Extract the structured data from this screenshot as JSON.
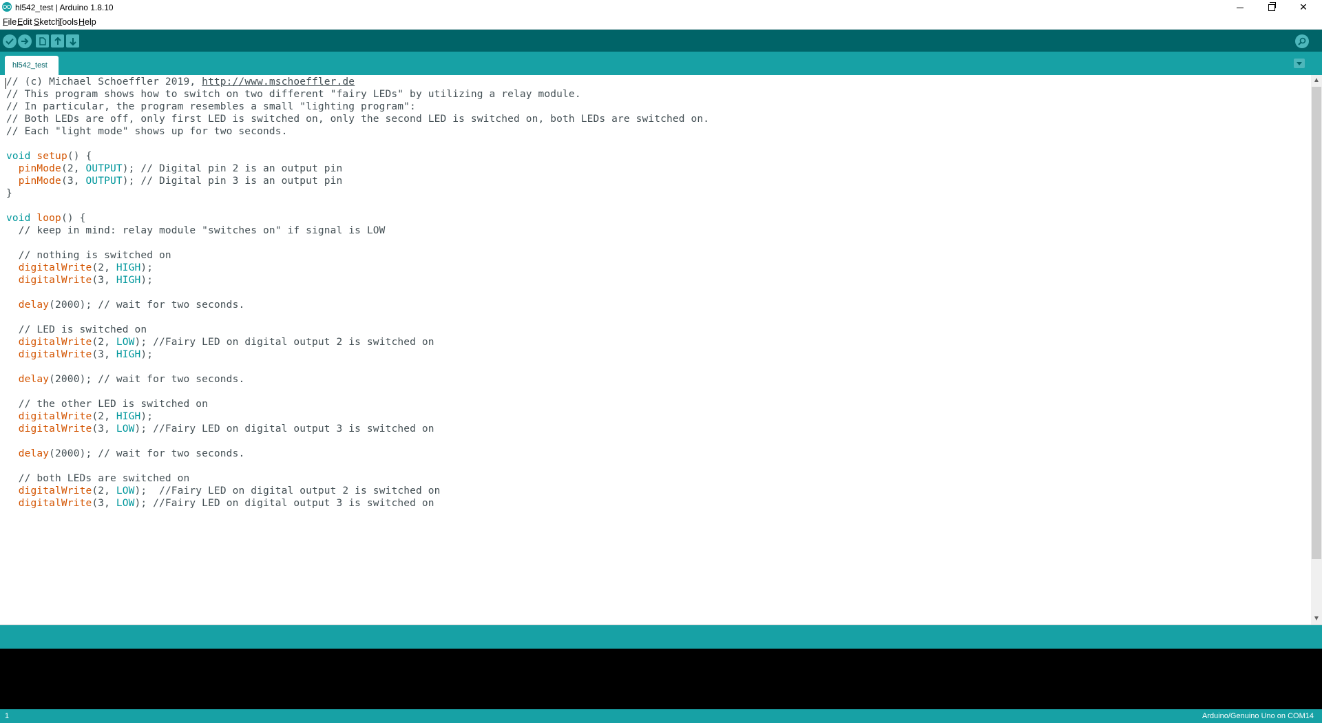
{
  "window": {
    "title": "hl542_test | Arduino 1.8.10",
    "controls": {
      "minimize": "minimize-icon",
      "restore": "restore-icon",
      "close": "✕"
    }
  },
  "menu": {
    "items": [
      "File",
      "Edit",
      "Sketch",
      "Tools",
      "Help"
    ]
  },
  "toolbar": {
    "buttons": [
      {
        "name": "verify",
        "icon": "checkmark-icon"
      },
      {
        "name": "upload",
        "icon": "arrow-right-icon"
      },
      {
        "name": "new",
        "icon": "document-icon"
      },
      {
        "name": "open",
        "icon": "arrow-up-icon"
      },
      {
        "name": "save",
        "icon": "arrow-down-icon"
      }
    ],
    "serial_monitor_icon": "magnifier-icon"
  },
  "tabs": {
    "items": [
      {
        "label": "hl542_test",
        "active": true
      }
    ],
    "menu_icon": "chevron-down-icon"
  },
  "editor": {
    "lines": [
      "// (c) Michael Schoeffler 2019, http://www.mschoeffler.de",
      "// This program shows how to switch on two different \"fairy LEDs\" by utilizing a relay module.",
      "// In particular, the program resembles a small \"lighting program\":",
      "// Both LEDs are off, only first LED is switched on, only the second LED is switched on, both LEDs are switched on.",
      "// Each \"light mode\" shows up for two seconds.",
      "",
      "void setup() {",
      "  pinMode(2, OUTPUT); // Digital pin 2 is an output pin",
      "  pinMode(3, OUTPUT); // Digital pin 3 is an output pin",
      "}",
      "",
      "void loop() {",
      "  // keep in mind: relay module \"switches on\" if signal is LOW",
      "",
      "  // nothing is switched on",
      "  digitalWrite(2, HIGH);",
      "  digitalWrite(3, HIGH);",
      "",
      "  delay(2000); // wait for two seconds.",
      "",
      "  // LED is switched on",
      "  digitalWrite(2, LOW); //Fairy LED on digital output 2 is switched on",
      "  digitalWrite(3, HIGH);",
      "",
      "  delay(2000); // wait for two seconds.",
      "",
      "  // the other LED is switched on",
      "  digitalWrite(2, HIGH);",
      "  digitalWrite(3, LOW); //Fairy LED on digital output 3 is switched on",
      "",
      "  delay(2000); // wait for two seconds.",
      "",
      "  // both LEDs are switched on",
      "  digitalWrite(2, LOW);  //Fairy LED on digital output 2 is switched on",
      "  digitalWrite(3, LOW); //Fairy LED on digital output 3 is switched on"
    ],
    "syntax_colors": {
      "text": "#434f54",
      "keyword": "#00979c",
      "function": "#d35400",
      "constant": "#00979c"
    }
  },
  "footer": {
    "line_number": "1",
    "board": "Arduino/Genuino Uno on COM14"
  },
  "colors": {
    "toolbar": "#006468",
    "tabbar": "#17a1a5",
    "button": "#4db7bb",
    "console": "#000000"
  }
}
